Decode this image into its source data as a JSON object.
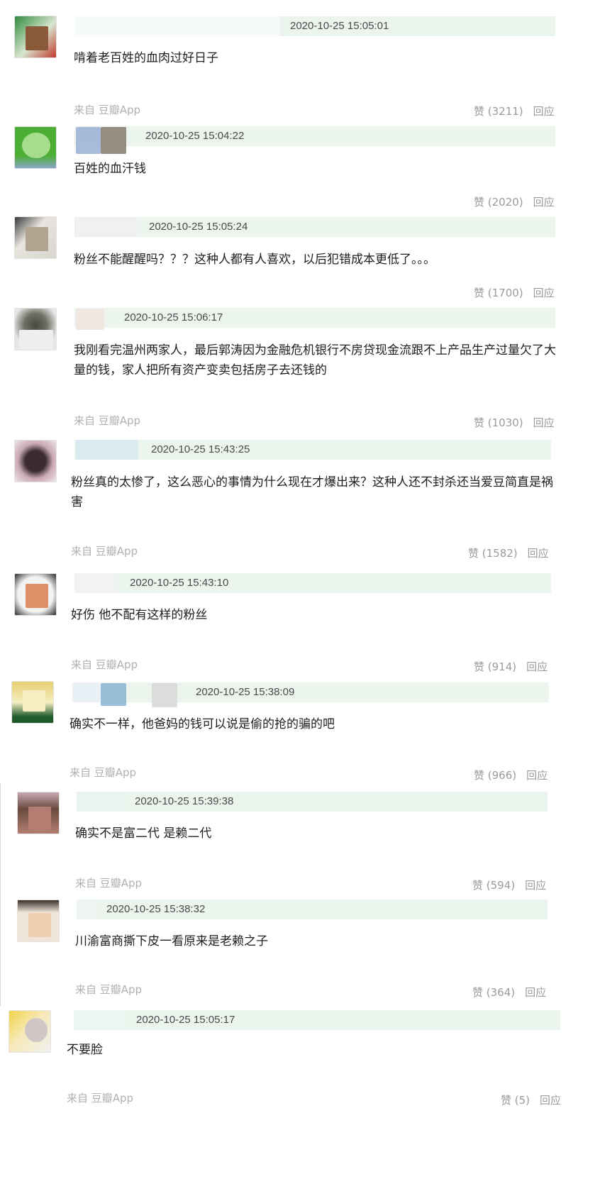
{
  "comments": [
    {
      "timestamp": "2020-10-25 15:05:01",
      "content": "啃着老百姓的血肉过好日子",
      "source": "来自 豆瓣App",
      "like_label": "赞 (3211)",
      "reply_label": "回应",
      "avatar_colors": [
        "#2f8a3b",
        "#8b5a3a"
      ],
      "name_colors": []
    },
    {
      "timestamp": "2020-10-25 15:04:22",
      "content": "百姓的血汗钱",
      "source": "",
      "like_label": "赞 (2020)",
      "reply_label": "回应",
      "avatar_colors": [
        "#4cae35",
        "#a6dd8c"
      ],
      "name_colors": [
        "#9fb4d6",
        "#8a8276"
      ]
    },
    {
      "timestamp": "2020-10-25 15:05:24",
      "content": "粉丝不能醒醒吗？？？这种人都有人喜欢，以后犯错成本更低了。。。",
      "source": "",
      "like_label": "赞 (1700)",
      "reply_label": "回应",
      "avatar_colors": [
        "#d8d4cf",
        "#b1a592"
      ],
      "name_colors": [
        "#f0f0f0"
      ]
    },
    {
      "timestamp": "2020-10-25 15:06:17",
      "content": "我刚看完温州两家人，最后郭涛因为金融危机银行不房贷现金流跟不上产品生产过量欠了大量的钱，家人把所有资产变卖包括房子去还钱的",
      "source": "来自 豆瓣App",
      "like_label": "赞 (1030)",
      "reply_label": "回应",
      "avatar_colors": [
        "#e6e6e6",
        "#474a40"
      ],
      "name_colors": [
        "#f1e6df"
      ]
    },
    {
      "timestamp": "2020-10-25 15:43:25",
      "content": "粉丝真的太惨了，这么恶心的事情为什么现在才爆出来？这种人还不封杀还当爱豆简直是祸害",
      "source": "来自 豆瓣App",
      "like_label": "赞 (1582)",
      "reply_label": "回应",
      "avatar_colors": [
        "#c9a8b3",
        "#3a2c30"
      ],
      "name_colors": [
        "#d7eaf1"
      ]
    },
    {
      "timestamp": "2020-10-25 15:43:10",
      "content": "好伤 他不配有这样的粉丝",
      "source": "来自 豆瓣App",
      "like_label": "赞 (914)",
      "reply_label": "回应",
      "avatar_colors": [
        "#f2f2f2",
        "#de8f68"
      ],
      "name_colors": [
        "#f2f2f2"
      ]
    },
    {
      "timestamp": "2020-10-25 15:38:09",
      "content": "确实不一样，他爸妈的钱可以说是偷的抢的骗的吧",
      "source": "来自 豆瓣App",
      "like_label": "赞 (966)",
      "reply_label": "回应",
      "avatar_colors": [
        "#1f5a2c",
        "#f4eec2"
      ],
      "name_colors": [
        "#e8f1f6",
        "#8fb7d4",
        "#d9d9d9"
      ]
    },
    {
      "timestamp": "2020-10-25 15:39:38",
      "content": "确实不是富二代 是赖二代",
      "source": "来自 豆瓣App",
      "like_label": "赞 (594)",
      "reply_label": "回应",
      "avatar_colors": [
        "#c8a7b3",
        "#b47d72"
      ],
      "name_colors": [
        "#e9f3f0"
      ]
    },
    {
      "timestamp": "2020-10-25 15:38:32",
      "content": "川渝富商撕下皮一看原来是老赖之子",
      "source": "来自 豆瓣App",
      "like_label": "赞 (364)",
      "reply_label": "回应",
      "avatar_colors": [
        "#efe6d9",
        "#efcfb0"
      ],
      "name_colors": [
        "#eef4f0"
      ]
    },
    {
      "timestamp": "2020-10-25 15:05:17",
      "content": "不要脸",
      "source": "来自 豆瓣App",
      "like_label": "赞 (5)",
      "reply_label": "回应",
      "avatar_colors": [
        "#f4d24a",
        "#cfc6c6"
      ],
      "name_colors": [
        "#eef6f1"
      ]
    }
  ]
}
